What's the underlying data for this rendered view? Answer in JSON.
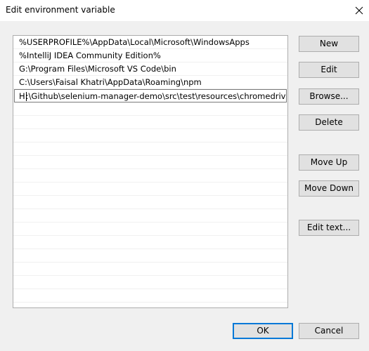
{
  "window": {
    "title": "Edit environment variable"
  },
  "list": {
    "items": [
      "%USERPROFILE%\\AppData\\Local\\Microsoft\\WindowsApps",
      "%IntelliJ IDEA Community Edition%",
      "G:\\Program Files\\Microsoft VS Code\\bin",
      "C:\\Users\\Faisal Khatri\\AppData\\Roaming\\npm"
    ],
    "editing_prefix": "H",
    "editing_rest": ":\\Github\\selenium-manager-demo\\src\\test\\resources\\chromedriver_w"
  },
  "buttons": {
    "new": "New",
    "edit": "Edit",
    "browse": "Browse...",
    "delete": "Delete",
    "move_up": "Move Up",
    "move_down": "Move Down",
    "edit_text": "Edit text...",
    "ok": "OK",
    "cancel": "Cancel"
  },
  "colors": {
    "accent": "#0078d7"
  },
  "icons": {
    "close": "close-icon"
  }
}
